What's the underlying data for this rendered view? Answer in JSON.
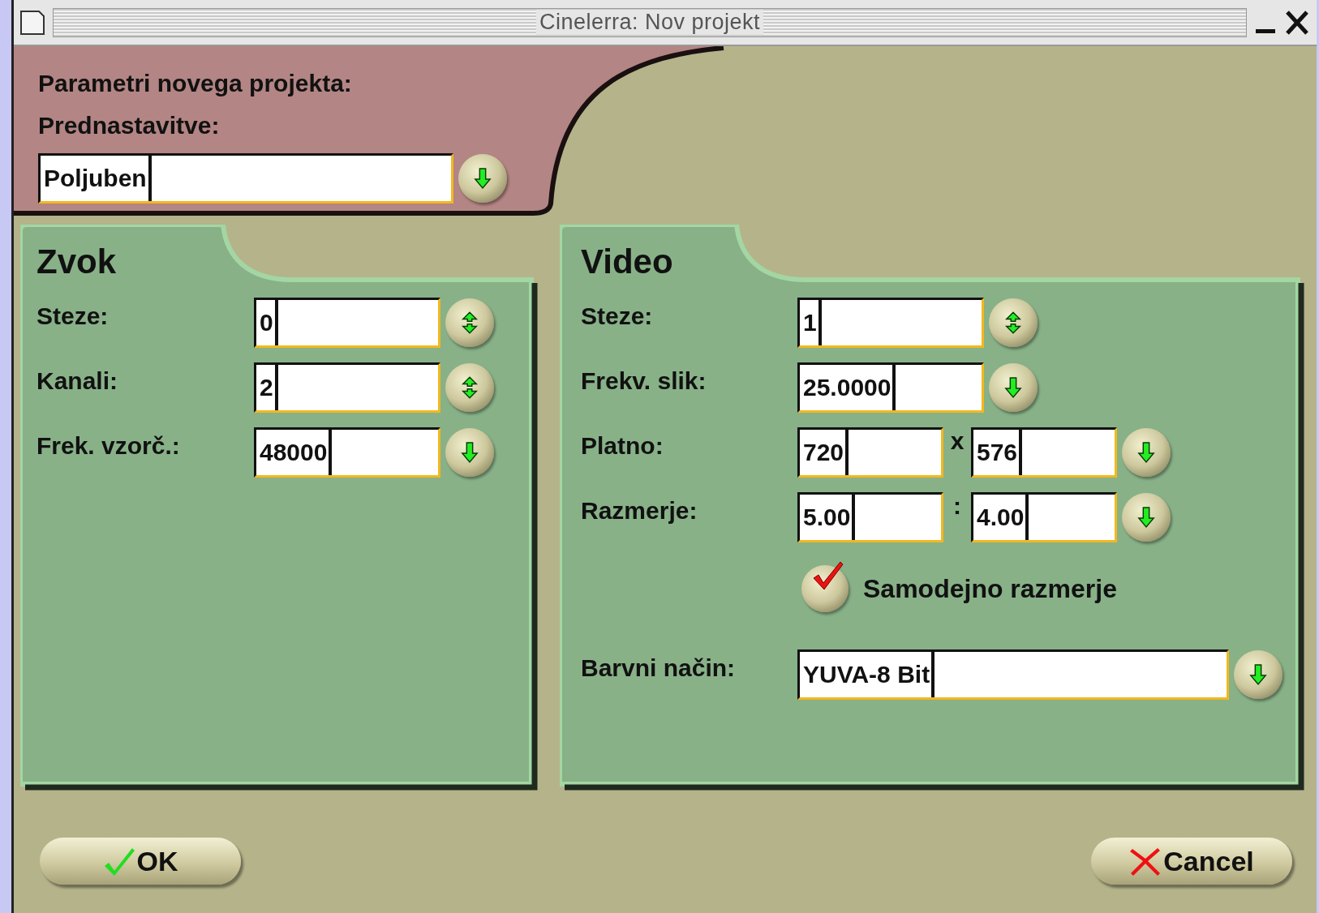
{
  "window": {
    "title": "Cinelerra: Nov projekt"
  },
  "presets": {
    "heading": "Parametri novega projekta:",
    "label": "Prednastavitve:",
    "value": "Poljuben"
  },
  "audio": {
    "title": "Zvok",
    "rows": [
      {
        "kind": "spin",
        "label": "Steze:",
        "values": [
          "0"
        ]
      },
      {
        "kind": "spin",
        "label": "Kanali:",
        "values": [
          "2"
        ]
      },
      {
        "kind": "menu",
        "label": "Frek. vzorč.:",
        "values": [
          "48000"
        ]
      }
    ]
  },
  "video": {
    "title": "Video",
    "rows": [
      {
        "kind": "spin",
        "label": "Steze:",
        "values": [
          "1"
        ]
      },
      {
        "kind": "menu",
        "label": "Frekv. slik:",
        "values": [
          "25.0000"
        ]
      },
      {
        "kind": "menu",
        "label": "Platno:",
        "values": [
          "720",
          "576"
        ],
        "separator": "x"
      },
      {
        "kind": "menu",
        "label": "Razmerje:",
        "values": [
          "5.00",
          "4.00"
        ],
        "separator": ":"
      },
      {
        "kind": "check",
        "label": "Samodejno razmerje",
        "checked": true
      },
      {
        "kind": "combo",
        "label": "Barvni način:",
        "values": [
          "YUVA-8 Bit"
        ]
      }
    ]
  },
  "buttons": [
    {
      "kind": "ok",
      "label": "OK"
    },
    {
      "kind": "cancel",
      "label": "Cancel"
    }
  ]
}
